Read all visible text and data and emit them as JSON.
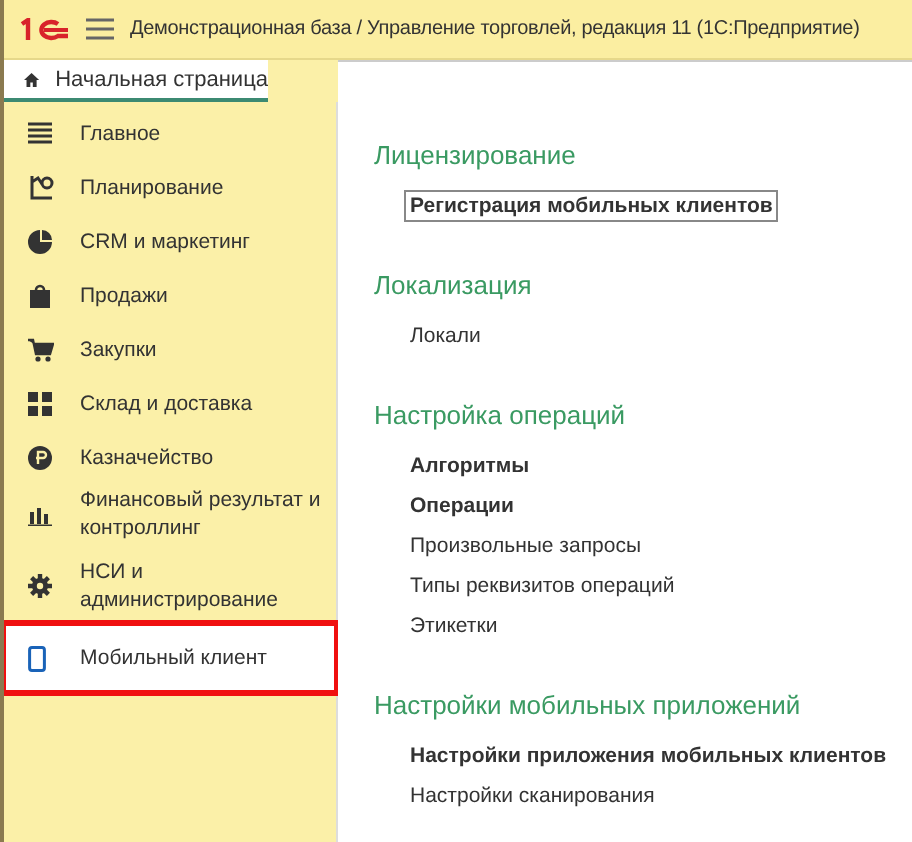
{
  "window": {
    "title": "Демонстрационная база / Управление торговлей, редакция 11  (1С:Предприятие)"
  },
  "tabs": [
    {
      "label": "Начальная страница",
      "selected": true
    }
  ],
  "sidebar": {
    "items": [
      {
        "label": "Главное",
        "selected": false,
        "highlighted": false
      },
      {
        "label": "Планирование",
        "selected": false,
        "highlighted": false
      },
      {
        "label": "CRM и маркетинг",
        "selected": false,
        "highlighted": false
      },
      {
        "label": "Продажи",
        "selected": false,
        "highlighted": false
      },
      {
        "label": "Закупки",
        "selected": false,
        "highlighted": false
      },
      {
        "label": "Склад и доставка",
        "selected": false,
        "highlighted": false
      },
      {
        "label": "Казначейство",
        "selected": false,
        "highlighted": false
      },
      {
        "label": "Финансовый результат и контроллинг",
        "selected": false,
        "highlighted": false
      },
      {
        "label": "НСИ и администрирование",
        "selected": false,
        "highlighted": false
      },
      {
        "label": "Мобильный клиент",
        "selected": true,
        "highlighted": true
      }
    ]
  },
  "sections": [
    {
      "title": "Лицензирование",
      "links": [
        {
          "label": "Регистрация мобильных клиентов",
          "bold": true,
          "focused": true
        }
      ]
    },
    {
      "title": "Локализация",
      "links": [
        {
          "label": "Локали",
          "bold": false,
          "focused": false
        }
      ]
    },
    {
      "title": "Настройка операций",
      "links": [
        {
          "label": "Алгоритмы",
          "bold": true,
          "focused": false
        },
        {
          "label": "Операции",
          "bold": true,
          "focused": false
        },
        {
          "label": "Произвольные запросы",
          "bold": false,
          "focused": false
        },
        {
          "label": "Типы реквизитов операций",
          "bold": false,
          "focused": false
        },
        {
          "label": "Этикетки",
          "bold": false,
          "focused": false
        }
      ]
    },
    {
      "title": "Настройки мобильных приложений",
      "links": [
        {
          "label": "Настройки приложения мобильных клиентов",
          "bold": true,
          "focused": false
        },
        {
          "label": "Настройки сканирования",
          "bold": false,
          "focused": false
        }
      ]
    }
  ]
}
